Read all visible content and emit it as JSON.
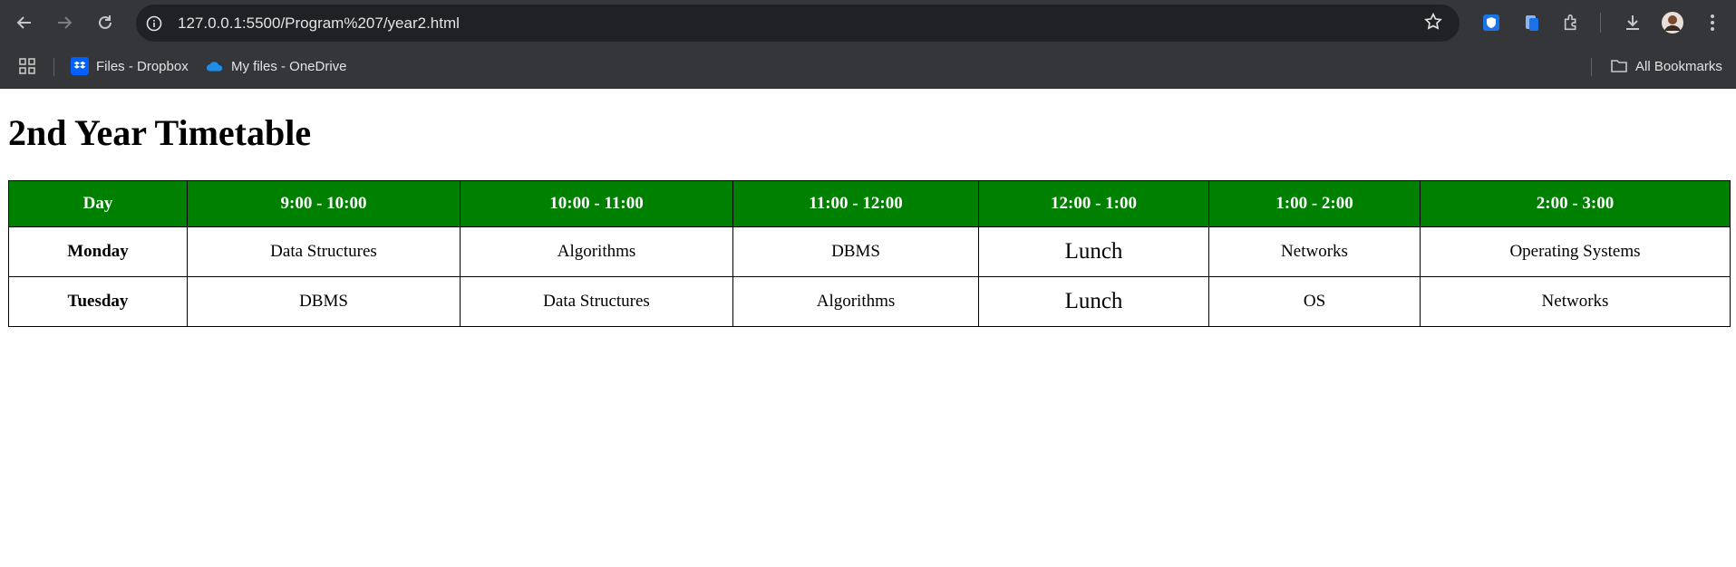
{
  "browser": {
    "url": "127.0.0.1:5500/Program%207/year2.html",
    "icons": {
      "back": "back-arrow-icon",
      "forward": "forward-arrow-icon",
      "reload": "reload-icon",
      "info": "info-icon",
      "bookmark": "star-icon",
      "downloads": "download-icon",
      "menu": "kebab-menu-icon"
    },
    "bookmarks": [
      {
        "label": "Files - Dropbox",
        "icon": "dropbox-icon"
      },
      {
        "label": "My files - OneDrive",
        "icon": "onedrive-icon"
      }
    ],
    "all_bookmarks": "All Bookmarks"
  },
  "page": {
    "title": "2nd Year Timetable",
    "header_color": "#008000",
    "timetable": {
      "headers": [
        "Day",
        "9:00 - 10:00",
        "10:00 - 11:00",
        "11:00 - 12:00",
        "12:00 - 1:00",
        "1:00 - 2:00",
        "2:00 - 3:00"
      ],
      "rows": [
        {
          "day": "Monday",
          "slots": [
            "Data Structures",
            "Algorithms",
            "DBMS",
            "Lunch",
            "Networks",
            "Operating Systems"
          ]
        },
        {
          "day": "Tuesday",
          "slots": [
            "DBMS",
            "Data Structures",
            "Algorithms",
            "Lunch",
            "OS",
            "Networks"
          ]
        }
      ]
    }
  }
}
